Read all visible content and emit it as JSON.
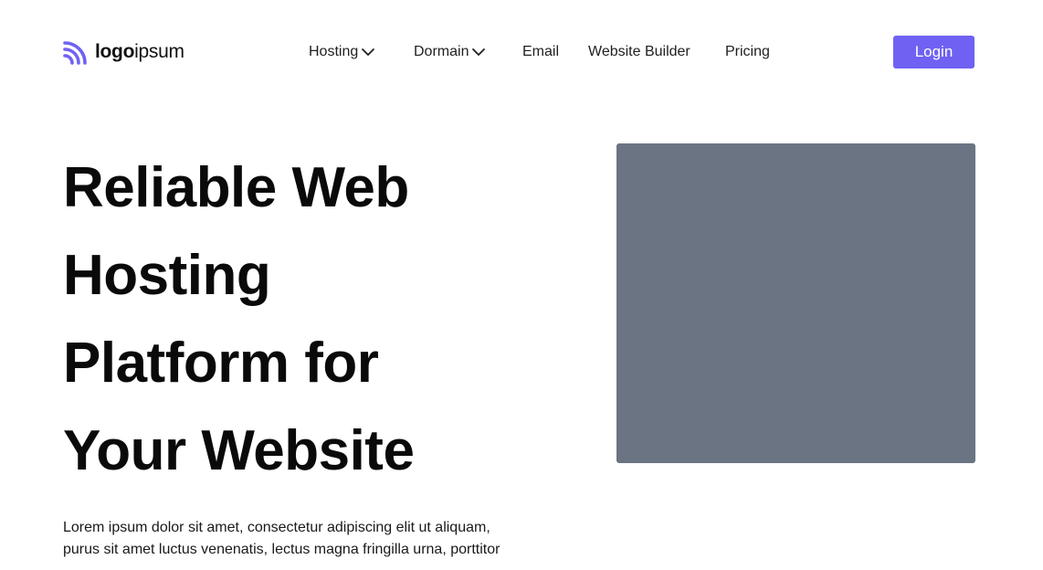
{
  "logo": {
    "bold_text": "logo",
    "light_text": "ipsum",
    "icon": "logo-arcs-icon",
    "color": "#6f62f3"
  },
  "nav": {
    "items": [
      {
        "label": "Hosting",
        "has_dropdown": true
      },
      {
        "label": "Dormain",
        "has_dropdown": true
      },
      {
        "label": "Email",
        "has_dropdown": false
      },
      {
        "label": "Website Builder",
        "has_dropdown": false
      },
      {
        "label": "Pricing",
        "has_dropdown": false
      }
    ]
  },
  "header": {
    "login_label": "Login",
    "login_color": "#6f62f3"
  },
  "hero": {
    "title_lines": [
      "Reliable Web",
      "Hosting",
      "Platform for",
      "Your Website"
    ],
    "description": "Lorem ipsum dolor sit amet, consectetur adipiscing elit ut aliquam, purus sit amet luctus venenatis, lectus magna fringilla urna, porttitor",
    "image_placeholder_color": "#6b7482"
  }
}
